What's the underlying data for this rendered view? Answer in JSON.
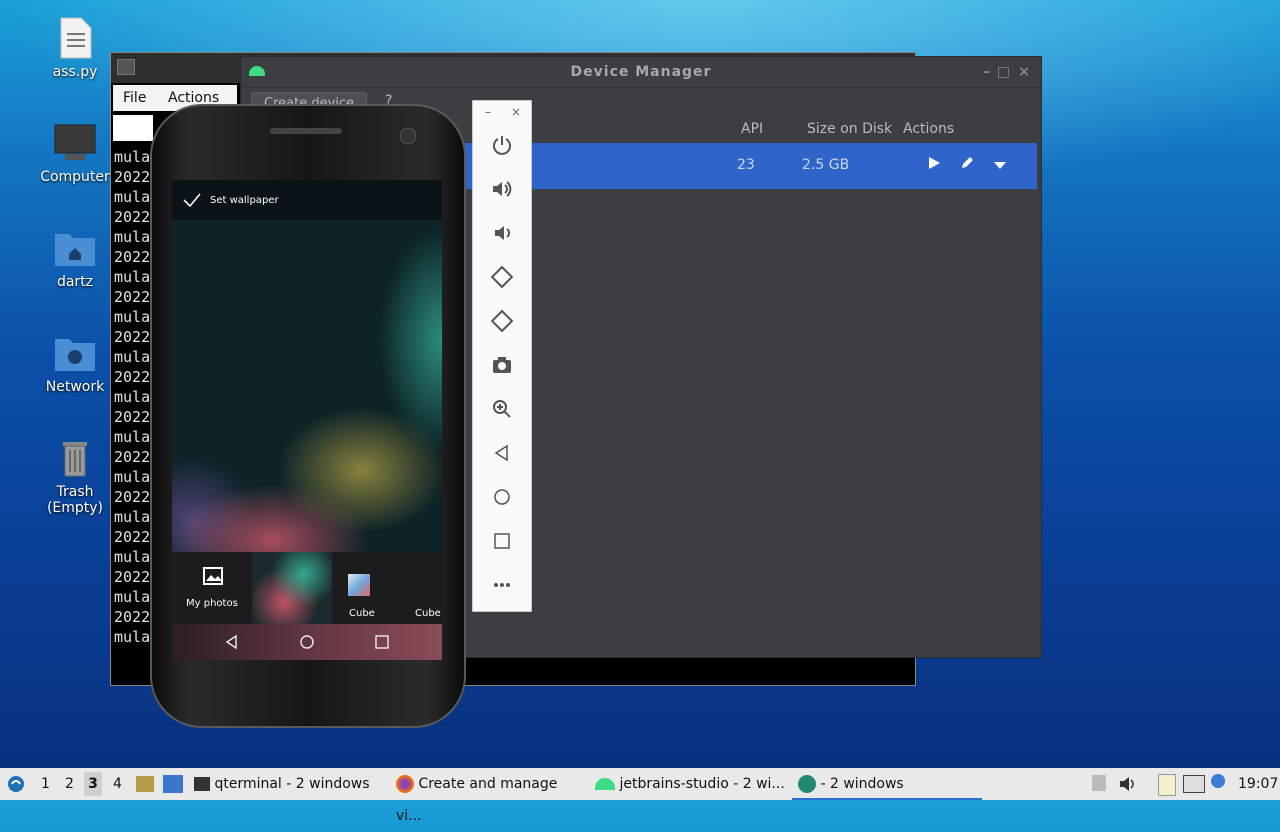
{
  "desktop": {
    "icons": [
      {
        "label": "ass.py",
        "icon": "text-file-icon"
      },
      {
        "label": "Computer",
        "icon": "computer-icon"
      },
      {
        "label": "dartz",
        "icon": "home-folder-icon"
      },
      {
        "label": "Network",
        "icon": "network-folder-icon"
      },
      {
        "label": "Trash (Empty)",
        "icon": "trash-icon"
      }
    ]
  },
  "terminal": {
    "menu": {
      "file": "File",
      "actions": "Actions"
    },
    "lines": [
      "mula",
      "2022",
      "mula",
      "2022",
      "mula",
      "2022",
      "mula",
      "2022",
      "mula",
      "2022",
      "mula",
      "2022",
      "mula",
      "2022",
      "mula",
      "2022",
      "mula",
      "2022",
      "mula",
      "2022",
      "mula",
      "2022",
      "mula",
      "2022",
      "mula"
    ]
  },
  "device_manager": {
    "title": "Device Manager",
    "create_device": "Create device",
    "help": "?",
    "columns": {
      "api": "API",
      "size": "Size on Disk",
      "actions": "Actions"
    },
    "rows": [
      {
        "api": "23",
        "size": "2.5 GB"
      }
    ]
  },
  "emulator": {
    "toolbar_icons": [
      "power-icon",
      "volume-up-icon",
      "volume-down-icon",
      "rotate-left-icon",
      "rotate-right-icon",
      "camera-icon",
      "zoom-icon",
      "back-icon",
      "home-icon",
      "overview-icon",
      "more-icon"
    ],
    "screen": {
      "set_wallpaper": "Set wallpaper",
      "my_photos": "My photos",
      "thumb1": "Cube",
      "thumb2": "Cube"
    }
  },
  "taskbar": {
    "workspaces": [
      "1",
      "2",
      "3",
      "4"
    ],
    "tasks": [
      {
        "label": "qterminal - 2 windows"
      },
      {
        "label": "Create and manage vi..."
      },
      {
        "label": "jetbrains-studio - 2 wi..."
      },
      {
        "label": "- 2 windows"
      }
    ],
    "clock": "19:07"
  }
}
